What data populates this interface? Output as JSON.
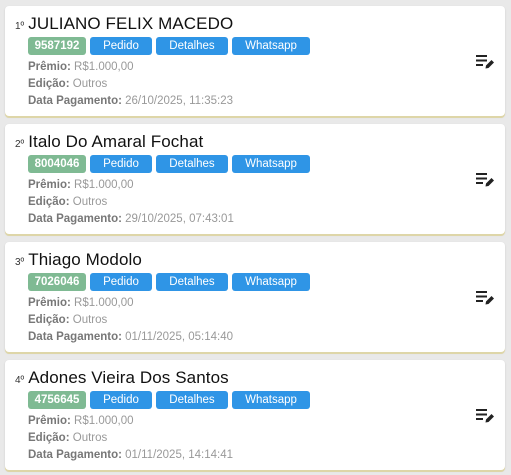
{
  "winners": [
    {
      "rank": "1º",
      "name": "JULIANO FELIX MACEDO",
      "order_id": "9587192",
      "buttons": {
        "pedido": "Pedido",
        "detalhes": "Detalhes",
        "whatsapp": "Whatsapp"
      },
      "premio_label": "Prêmio:",
      "premio": "R$1.000,00",
      "edicao_label": "Edição:",
      "edicao": "Outros",
      "data_label": "Data Pagamento:",
      "data": "26/10/2025, 11:35:23"
    },
    {
      "rank": "2º",
      "name": "Italo Do Amaral Fochat",
      "order_id": "8004046",
      "buttons": {
        "pedido": "Pedido",
        "detalhes": "Detalhes",
        "whatsapp": "Whatsapp"
      },
      "premio_label": "Prêmio:",
      "premio": "R$1.000,00",
      "edicao_label": "Edição:",
      "edicao": "Outros",
      "data_label": "Data Pagamento:",
      "data": "29/10/2025, 07:43:01"
    },
    {
      "rank": "3º",
      "name": "Thiago Modolo",
      "order_id": "7026046",
      "buttons": {
        "pedido": "Pedido",
        "detalhes": "Detalhes",
        "whatsapp": "Whatsapp"
      },
      "premio_label": "Prêmio:",
      "premio": "R$1.000,00",
      "edicao_label": "Edição:",
      "edicao": "Outros",
      "data_label": "Data Pagamento:",
      "data": "01/11/2025, 05:14:40"
    },
    {
      "rank": "4º",
      "name": "Adones Vieira Dos Santos",
      "order_id": "4756645",
      "buttons": {
        "pedido": "Pedido",
        "detalhes": "Detalhes",
        "whatsapp": "Whatsapp"
      },
      "premio_label": "Prêmio:",
      "premio": "R$1.000,00",
      "edicao_label": "Edição:",
      "edicao": "Outros",
      "data_label": "Data Pagamento:",
      "data": "01/11/2025, 14:14:41"
    }
  ],
  "icons": {
    "edit": "edit-list-icon"
  },
  "colors": {
    "order_badge": "#7fba93",
    "button": "#2f95e6",
    "card_accent": "#ded6a8"
  }
}
